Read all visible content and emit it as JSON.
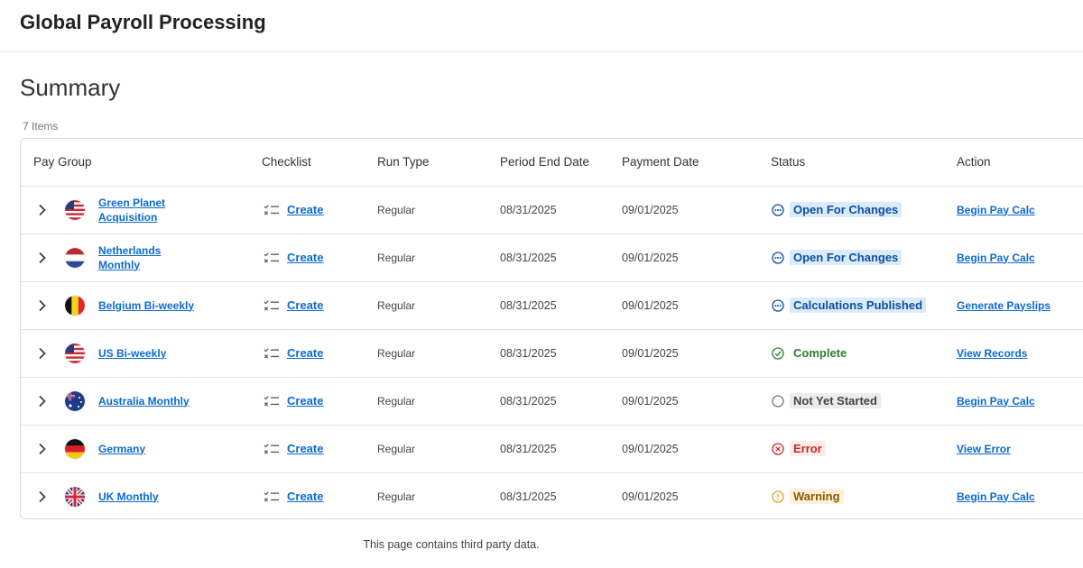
{
  "app": {
    "title": "Global Payroll Processing"
  },
  "summary": {
    "title": "Summary",
    "item_count": "7 Items"
  },
  "table": {
    "headers": {
      "pay_group": "Pay Group",
      "checklist": "Checklist",
      "run_type": "Run Type",
      "period_end_date": "Period End Date",
      "payment_date": "Payment Date",
      "status": "Status",
      "action": "Action"
    },
    "rows": [
      {
        "pay_group": "Green Planet Acquisition",
        "flag": "us-flag-icon",
        "checklist": "Create",
        "run_type": "Regular",
        "period_end_date": "08/31/2025",
        "payment_date": "09/01/2025",
        "status": "Open For Changes",
        "status_kind": "open",
        "action": "Begin Pay Calc"
      },
      {
        "pay_group": "Netherlands Monthly",
        "flag": "netherlands-flag-icon",
        "checklist": "Create",
        "run_type": "Regular",
        "period_end_date": "08/31/2025",
        "payment_date": "09/01/2025",
        "status": "Open For Changes",
        "status_kind": "open",
        "action": "Begin Pay Calc"
      },
      {
        "pay_group": "Belgium Bi-weekly",
        "flag": "belgium-flag-icon",
        "checklist": "Create",
        "run_type": "Regular",
        "period_end_date": "08/31/2025",
        "payment_date": "09/01/2025",
        "status": "Calculations Published",
        "status_kind": "open",
        "action": "Generate Payslips"
      },
      {
        "pay_group": "US Bi-weekly",
        "flag": "us-flag-icon",
        "checklist": "Create",
        "run_type": "Regular",
        "period_end_date": "08/31/2025",
        "payment_date": "09/01/2025",
        "status": "Complete",
        "status_kind": "complete",
        "action": "View Records"
      },
      {
        "pay_group": "Australia Monthly",
        "flag": "australia-flag-icon",
        "checklist": "Create",
        "run_type": "Regular",
        "period_end_date": "08/31/2025",
        "payment_date": "09/01/2025",
        "status": "Not Yet Started",
        "status_kind": "notstarted",
        "action": "Begin Pay Calc"
      },
      {
        "pay_group": "Germany",
        "flag": "germany-flag-icon",
        "checklist": "Create",
        "run_type": "Regular",
        "period_end_date": "08/31/2025",
        "payment_date": "09/01/2025",
        "status": "Error",
        "status_kind": "error",
        "action": "View Error"
      },
      {
        "pay_group": "UK Monthly",
        "flag": "uk-flag-icon",
        "checklist": "Create",
        "run_type": "Regular",
        "period_end_date": "08/31/2025",
        "payment_date": "09/01/2025",
        "status": "Warning",
        "status_kind": "warning",
        "action": "Begin Pay Calc"
      }
    ]
  },
  "status_styles": {
    "open": {
      "fg": "#0a4f9e",
      "bg": "#dcebfa",
      "icon": "ellipsis-circle-icon"
    },
    "complete": {
      "fg": "#2e7d32",
      "bg": "#ffffff",
      "icon": "check-circle-icon"
    },
    "notstarted": {
      "fg": "#444444",
      "bg": "#ececec",
      "icon": "empty-circle-icon"
    },
    "error": {
      "fg": "#c62828",
      "bg": "#fdecec",
      "icon": "x-circle-icon"
    },
    "warning": {
      "fg": "#8a5a00",
      "bg": "#fdf1dc",
      "icon": "exclamation-circle-icon"
    }
  },
  "colors": {
    "link": "#0b6bcf",
    "border": "#dcdcdc"
  },
  "footer": {
    "note": "This page contains third party data."
  }
}
